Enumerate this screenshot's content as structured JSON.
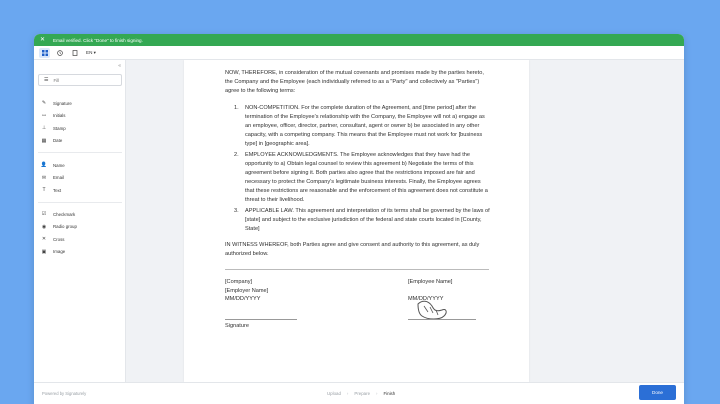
{
  "banner": {
    "text": "Email verified. Click \"Done\" to finish signing."
  },
  "toolbar": {
    "language": "EN ▾"
  },
  "sidebar": {
    "fill_label": "Fill",
    "signature_tools": [
      {
        "label": "Signature",
        "icon": "pen-icon"
      },
      {
        "label": "Initials",
        "icon": "initials-icon"
      },
      {
        "label": "Stamp",
        "icon": "stamp-icon"
      },
      {
        "label": "Date",
        "icon": "calendar-icon"
      }
    ],
    "field_tools": [
      {
        "label": "Name",
        "icon": "person-icon"
      },
      {
        "label": "Email",
        "icon": "mail-icon"
      },
      {
        "label": "Text",
        "icon": "text-icon"
      }
    ],
    "mark_tools": [
      {
        "label": "Checkmark",
        "icon": "checkbox-icon"
      },
      {
        "label": "Radio group",
        "icon": "radio-icon"
      },
      {
        "label": "Cross",
        "icon": "cross-icon"
      },
      {
        "label": "Image",
        "icon": "image-icon"
      }
    ]
  },
  "document": {
    "intro": "NOW, THEREFORE, in consideration of the mutual covenants and promises made by the parties hereto, the Company and the Employee (each individually referred to as a \"Party\" and collectively as \"Parties\") agree to the following terms:",
    "clauses": [
      {
        "number": "1.",
        "text": "NON-COMPETITION. For the complete duration of the Agreement, and [time period] after the termination of the Employee's relationship with the Company, the Employee will not a) engage as an employee, officer, director, partner, consultant, agent or owner b) be associated in any other capacity, with a competing company. This means that the Employee must not work for [business type] in [geographic area]."
      },
      {
        "number": "2.",
        "text": "EMPLOYEE ACKNOWLEDGMENTS. The Employee acknowledges that they have had the opportunity to a) Obtain legal counsel to review this agreement b) Negotiate the terms of this agreement before signing it. Both parties also agree that the restrictions imposed are fair and necessary to protect the Company's legitimate business interests. Finally, the Employee agrees that these restrictions are reasonable and the enforcement of this agreement does not constitute a threat to their livelihood."
      },
      {
        "number": "3.",
        "text": "APPLICABLE LAW. This agreement and interpretation of its terms shall be governed by the laws of [state] and subject to the exclusive jurisdiction of the federal and state courts located in [County, State]"
      }
    ],
    "witness": "IN WITNESS WHEREOF, both Parties agree and give consent and authority to this agreement, as duly authorized below.",
    "company": {
      "line1": "[Company]",
      "line2": "[Employer Name]",
      "date": "MM/DD/YYYY",
      "signature_label": "Signature"
    },
    "employee": {
      "line1": "[Employee Name]",
      "date": "MM/DD/YYYY"
    }
  },
  "footer": {
    "powered_by": "Powered by Signaturely",
    "steps": [
      "Upload",
      "Prepare",
      "Finish"
    ],
    "done_label": "Done"
  },
  "colors": {
    "background": "#6aa7f0",
    "banner": "#34a853",
    "primary": "#2b6fd6"
  }
}
